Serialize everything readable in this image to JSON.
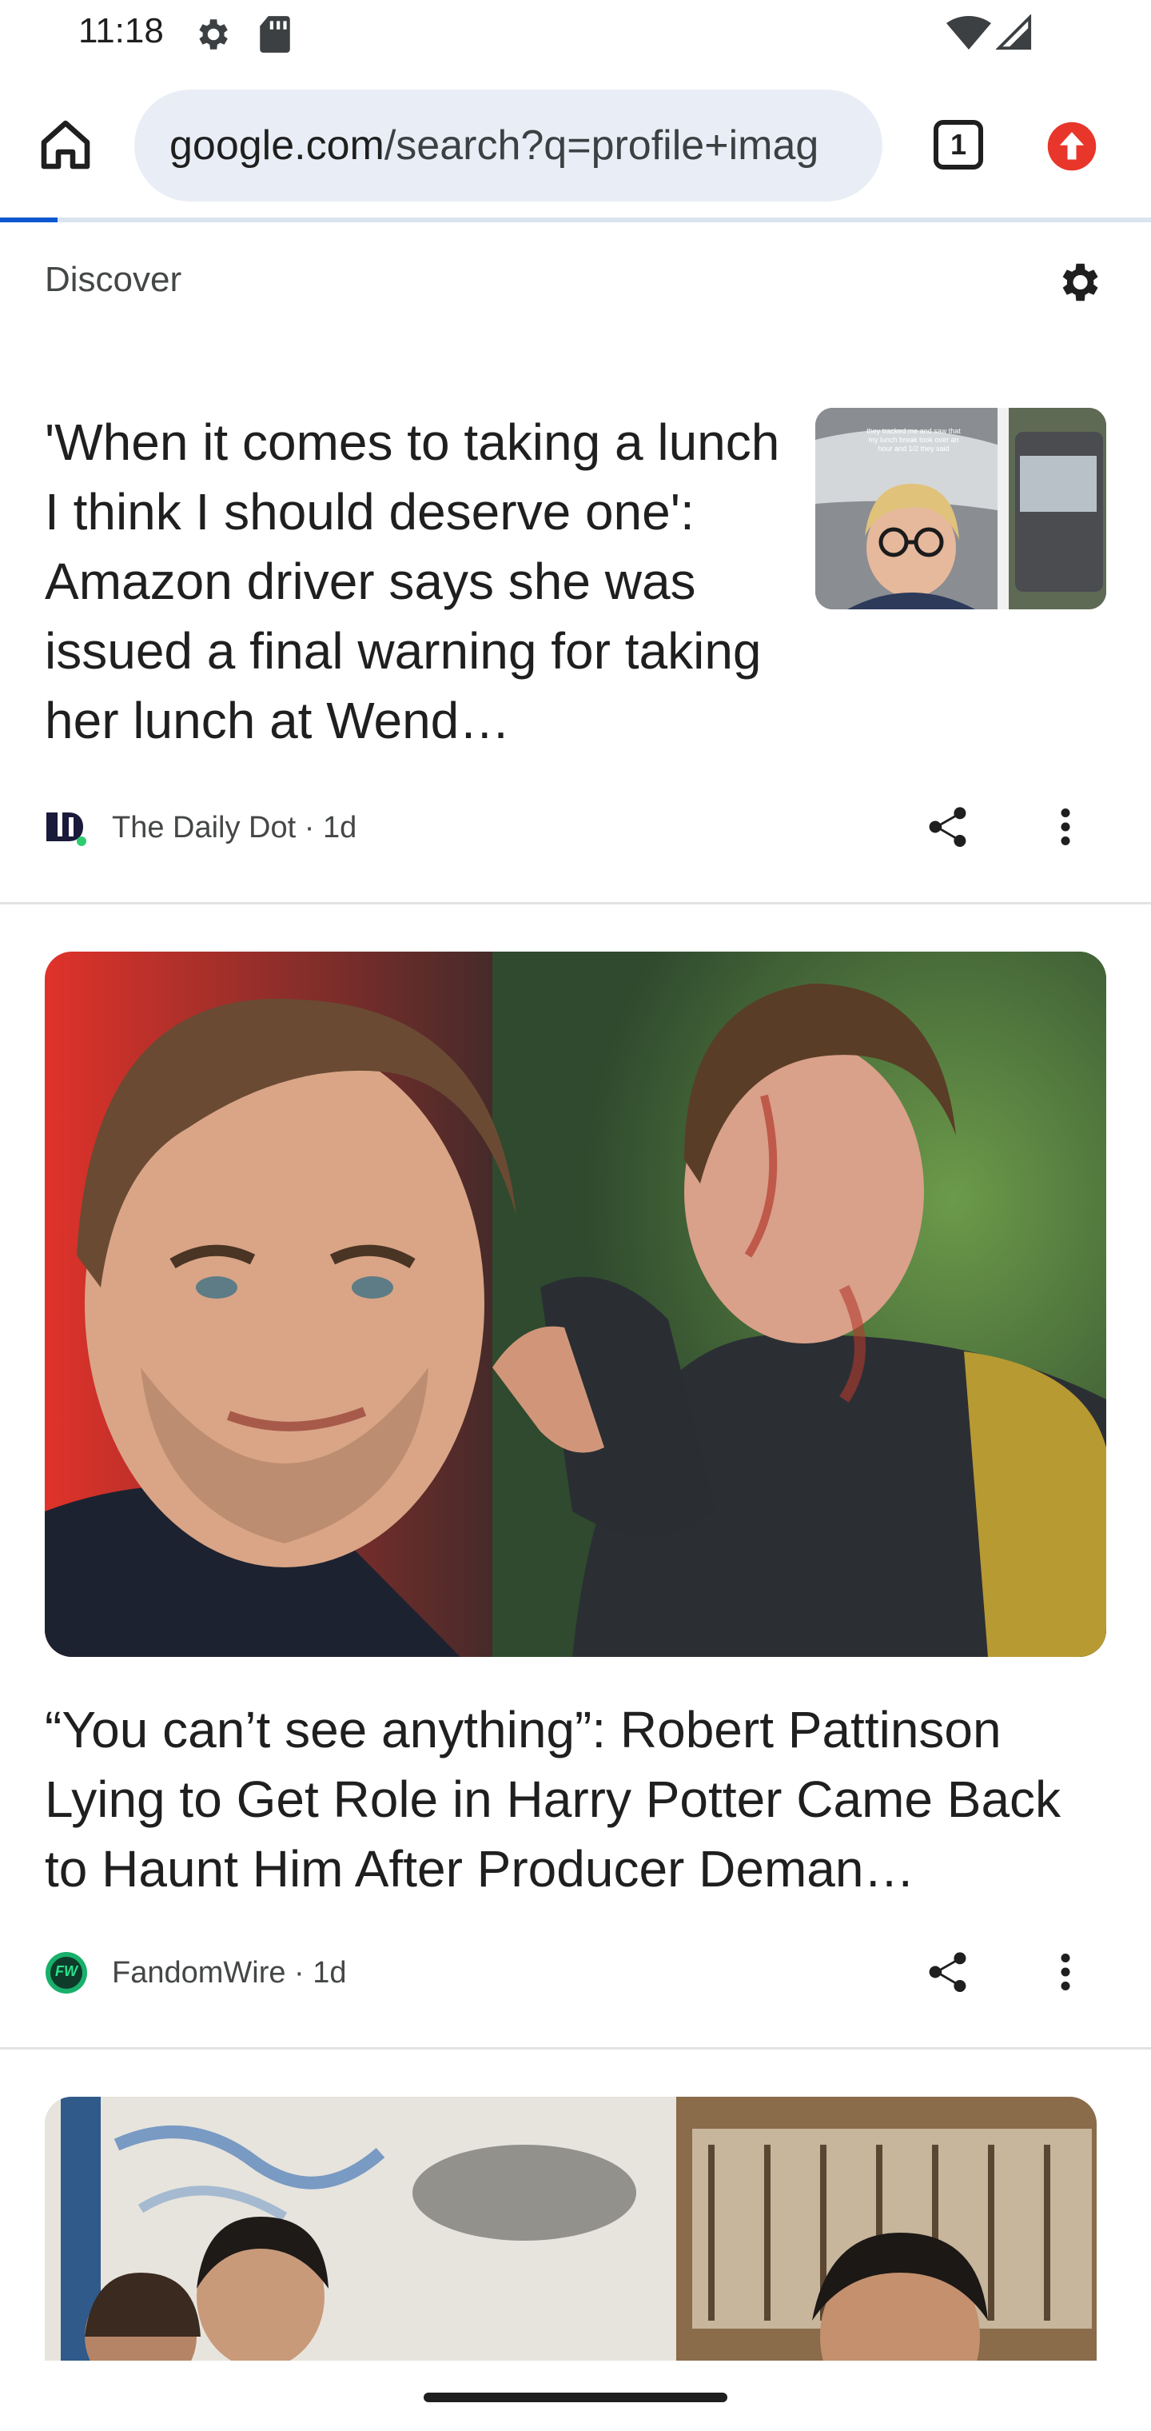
{
  "status_bar": {
    "time": "11:18"
  },
  "browser": {
    "url_domain": "google.com",
    "url_path": "/search?q=profile+imag",
    "tab_count": "1"
  },
  "discover": {
    "title": "Discover"
  },
  "cards": [
    {
      "headline": "'When it comes to taking a lunch I think I should deserve one': Amazon driver says she was issued a final warning for taking her lunch at Wend…",
      "source": "The Daily Dot",
      "age": "1d",
      "thumb_caption": "they tracked me and saw that my lunch break took over an hour and 1/2 they said"
    },
    {
      "headline": "“You can’t see anything”: Robert Pattinson Lying to Get Role in Harry Potter Came Back to Haunt Him After Producer Deman…",
      "source": "FandomWire",
      "age": "1d",
      "source_logo_text": "FW"
    }
  ],
  "colors": {
    "accent": "#0b57d0",
    "update_badge": "#e8362a",
    "url_bar_bg": "#e9eef6"
  },
  "icons": [
    "gear-icon",
    "sd-card-icon",
    "wifi-icon",
    "signal-icon",
    "home-icon",
    "tab-switcher-icon",
    "update-icon",
    "settings-icon",
    "share-icon",
    "more-vert-icon"
  ]
}
